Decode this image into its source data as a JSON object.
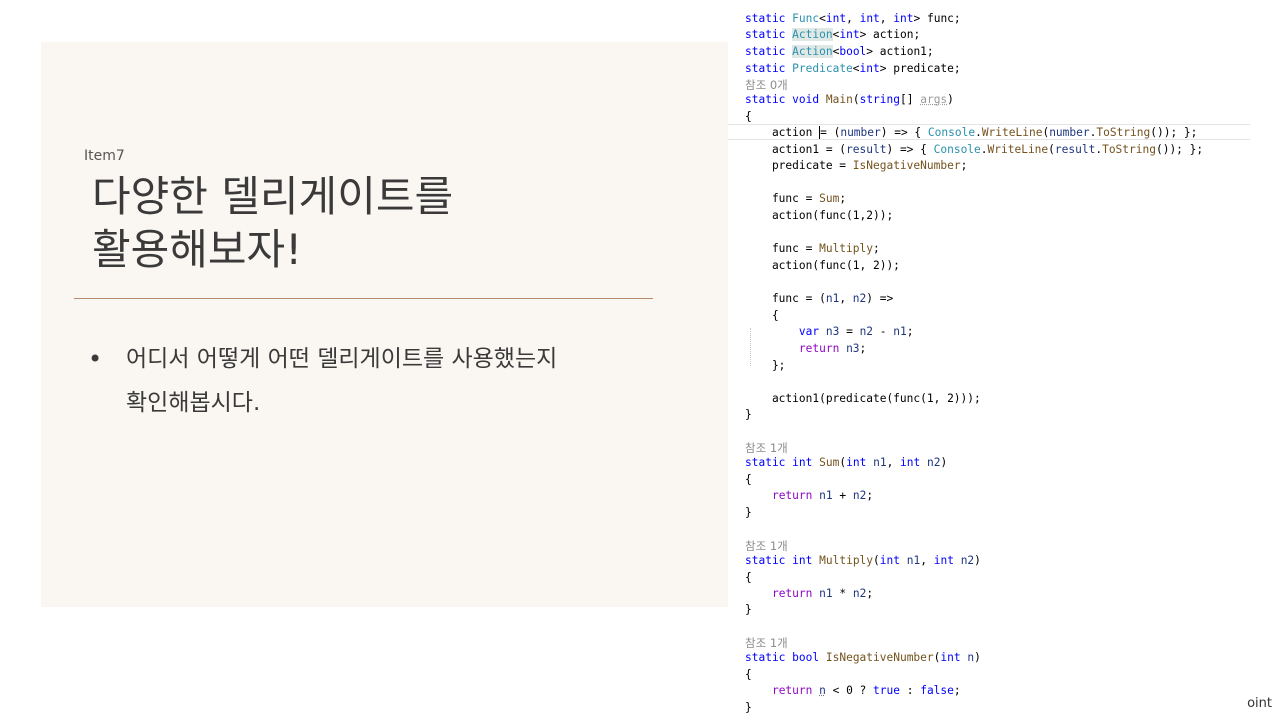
{
  "slide": {
    "item_tag": "Item7",
    "title_lines": [
      "다양한 델리게이트를",
      "활용해보자!"
    ],
    "bullet_marker": "•",
    "bullet_lines": [
      "어디서 어떻게 어떤 델리게이트를 사용했는지",
      "확인해봅시다."
    ]
  },
  "code": {
    "ref_0": "참조 0개",
    "ref_1": "참조 1개"
  },
  "footer": {
    "text": "oint"
  }
}
